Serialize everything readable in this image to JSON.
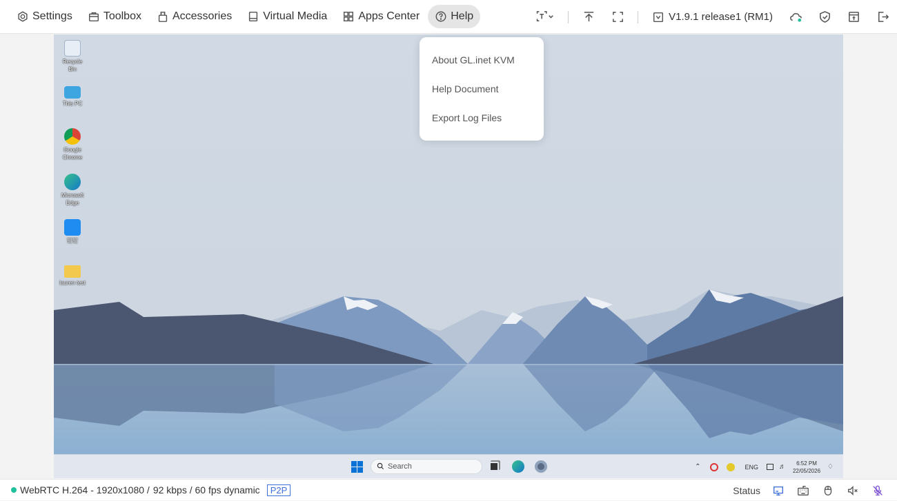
{
  "menu": {
    "settings": "Settings",
    "toolbox": "Toolbox",
    "accessories": "Accessories",
    "virtual_media": "Virtual Media",
    "apps_center": "Apps Center",
    "help": "Help"
  },
  "version": "V1.9.1 release1 (RM1)",
  "help_menu": {
    "items": [
      "About GL.inet KVM",
      "Help Document",
      "Export Log Files"
    ]
  },
  "desktop": {
    "icons": [
      "Recycle Bin",
      "This PC",
      "Google Chrome",
      "Microsoft Edge",
      "钉钉",
      "lauren test"
    ],
    "taskbar_search": "Search",
    "lang": "ENG",
    "time": "6:52 PM",
    "date": "22/05/2026"
  },
  "status": {
    "stream": "WebRTC H.264 - 1920x1080 /",
    "bitrate": "92 kbps / 60 fps dynamic",
    "p2p": "P2P",
    "status_label": "Status"
  },
  "colors": {
    "accent_green": "#1ec19b",
    "p2p_blue": "#3d6fd6"
  }
}
